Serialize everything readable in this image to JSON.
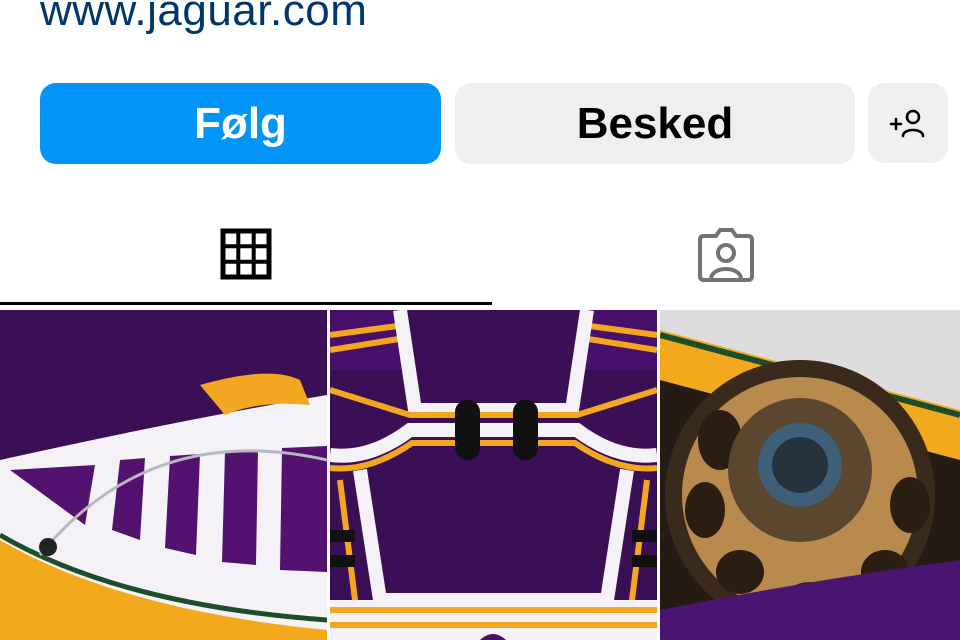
{
  "profile": {
    "website": "www.jaguar.com"
  },
  "actions": {
    "follow_label": "Følg",
    "message_label": "Besked",
    "add_user_icon": "add-person-icon"
  },
  "tabs": [
    {
      "icon": "grid-icon",
      "selected": true
    },
    {
      "icon": "tagged-person-icon",
      "selected": false
    }
  ],
  "colors": {
    "website_link": "#00376b",
    "follow_button": "#0095f6",
    "secondary_button": "#efefef",
    "livery_purple": "#3d0a5c",
    "livery_yellow": "#f2a91c"
  },
  "posts": [
    {
      "subject": "purple-white-livery-bodywork"
    },
    {
      "subject": "purple-yellow-livery-engine-cover"
    },
    {
      "subject": "gold-wheel-closeup"
    }
  ]
}
